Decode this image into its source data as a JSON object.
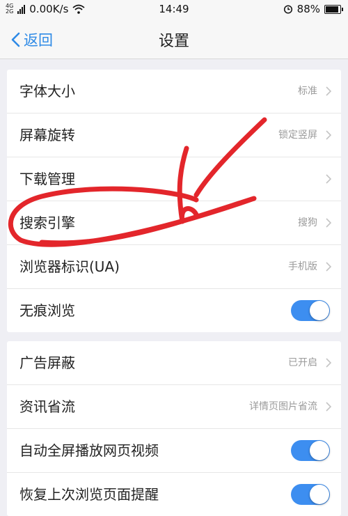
{
  "status_bar": {
    "network_top": "4G",
    "network_bottom": "2G",
    "speed": "0.00K/s",
    "time": "14:49",
    "battery": "88%",
    "battery_level": 0.88
  },
  "nav": {
    "back_label": "返回",
    "title": "设置"
  },
  "colors": {
    "accent": "#2e8ae6",
    "toggle_on": "#3d8ef0",
    "annotation": "#e3262b"
  },
  "group1": [
    {
      "label": "字体大小",
      "value": "标准",
      "control": "chevron"
    },
    {
      "label": "屏幕旋转",
      "value": "锁定竖屏",
      "control": "chevron"
    },
    {
      "label": "下载管理",
      "value": "",
      "control": "chevron"
    },
    {
      "label": "搜索引擎",
      "value": "搜狗",
      "control": "chevron"
    },
    {
      "label": "浏览器标识(UA)",
      "value": "手机版",
      "control": "chevron"
    },
    {
      "label": "无痕浏览",
      "control": "toggle",
      "on": true
    }
  ],
  "group2": [
    {
      "label": "广告屏蔽",
      "value": "已开启",
      "control": "chevron"
    },
    {
      "label": "资讯省流",
      "value": "详情页图片省流",
      "control": "chevron"
    },
    {
      "label": "自动全屏播放网页视频",
      "control": "toggle",
      "on": true
    },
    {
      "label": "恢复上次浏览页面提醒",
      "control": "toggle",
      "on": true
    }
  ]
}
